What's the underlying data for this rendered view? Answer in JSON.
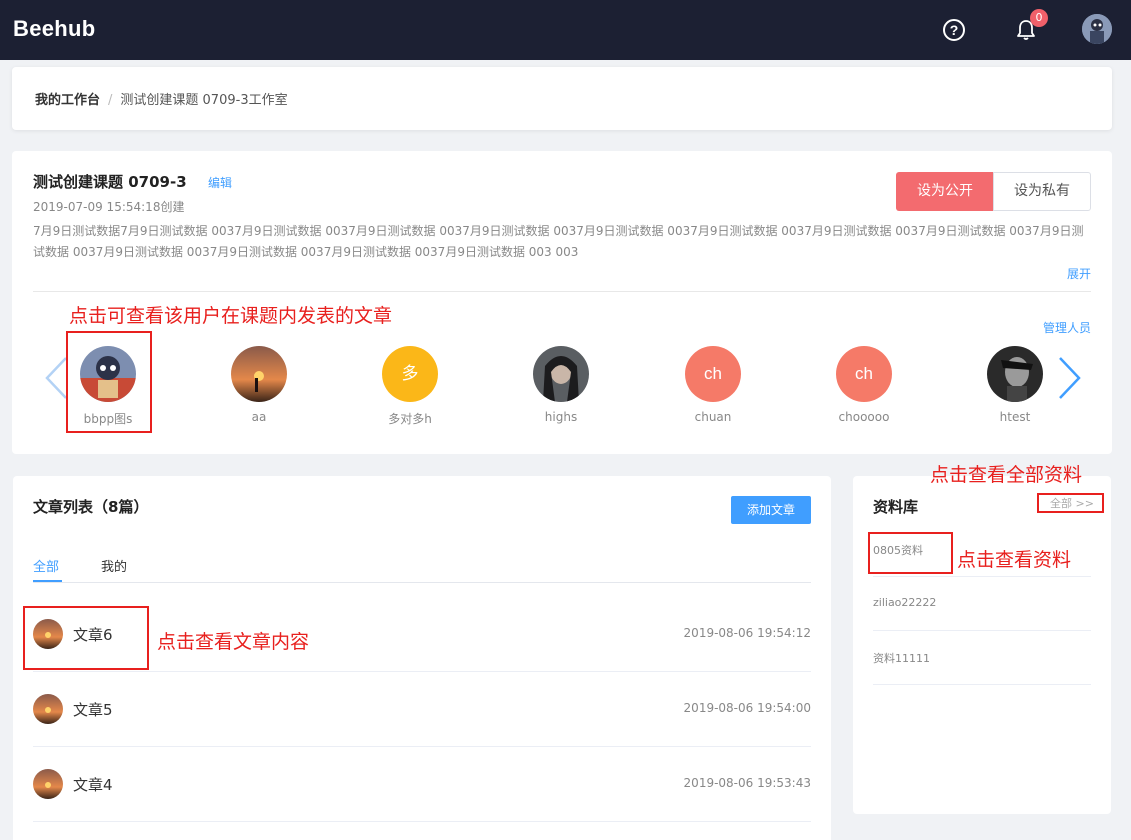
{
  "header": {
    "logo": "Beehub",
    "help": "?",
    "notifications": "0"
  },
  "breadcrumb": {
    "root": "我的工作台",
    "separator": "/",
    "current": "测试创建课题 0709-3工作室"
  },
  "topic": {
    "title": "测试创建课题 0709-3",
    "edit": "编辑",
    "created": "2019-07-09 15:54:18创建",
    "public_btn": "设为公开",
    "private_btn": "设为私有",
    "description": "7月9日测试数据7月9日测试数据 0037月9日测试数据 0037月9日测试数据 0037月9日测试数据 0037月9日测试数据 0037月9日测试数据 0037月9日测试数据 0037月9日测试数据 0037月9日测试数据 0037月9日测试数据 0037月9日测试数据 0037月9日测试数据 0037月9日测试数据 003 003",
    "expand": "展开",
    "manage": "管理人员"
  },
  "members": [
    {
      "name": "bbpp图s",
      "initial": "",
      "color": "#6b7a9a"
    },
    {
      "name": "aa",
      "initial": "",
      "color": "#b86a3a"
    },
    {
      "name": "多对多h",
      "initial": "多",
      "color": "#fbb718"
    },
    {
      "name": "highs",
      "initial": "",
      "color": "#4a4f52"
    },
    {
      "name": "chuan",
      "initial": "ch",
      "color": "#f57a68"
    },
    {
      "name": "chooooo",
      "initial": "ch",
      "color": "#f57a68"
    },
    {
      "name": "htest",
      "initial": "",
      "color": "#2a2a2a"
    }
  ],
  "articles": {
    "title": "文章列表（8篇）",
    "add_btn": "添加文章",
    "tabs": [
      "全部",
      "我的"
    ],
    "items": [
      {
        "title": "文章6",
        "time": "2019-08-06 19:54:12"
      },
      {
        "title": "文章5",
        "time": "2019-08-06 19:54:00"
      },
      {
        "title": "文章4",
        "time": "2019-08-06 19:53:43"
      }
    ]
  },
  "library": {
    "title": "资料库",
    "all_link": "全部 >>",
    "items": [
      "0805资料",
      "ziliao22222",
      "资料11111"
    ]
  },
  "annotations": {
    "member": "点击可查看该用户在课题内发表的文章",
    "all": "点击查看全部资料",
    "item": "点击查看资料",
    "article": "点击查看文章内容"
  },
  "colors": {
    "topbar": "#1c2033",
    "accent": "#409eff",
    "public_btn": "#f36b6f",
    "annotation": "#e8201e"
  }
}
